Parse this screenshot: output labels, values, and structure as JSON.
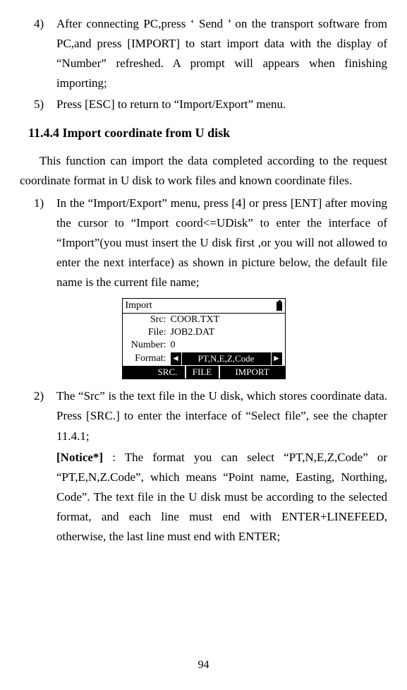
{
  "list": {
    "item4": {
      "marker": "4)",
      "text": "After connecting PC,press ‘ Send ’ on the transport software from PC,and press [IMPORT] to start import data with the display of “Number” refreshed. A prompt will appears when finishing importing;"
    },
    "item5": {
      "marker": "5)",
      "text": "Press [ESC] to return to “Import/Export” menu."
    }
  },
  "heading": "11.4.4 Import coordinate from U disk",
  "intro": "This function can import the data completed according to the request coordinate format in U disk to work files and known coordinate files.",
  "steps": {
    "s1": {
      "marker": "1)",
      "text": "In the “Import/Export” menu, press [4] or press [ENT] after moving the cursor to “Import coord<=UDisk” to enter the interface of “Import”(you must insert the U disk first ,or you will not allowed to enter the next interface) as shown in picture below, the default file name is the current file name;"
    },
    "s2": {
      "marker": "2)",
      "text": "The “Src” is the text file in the U disk, which stores coordinate data. Press [SRC.] to enter the interface of “Select file”, see the chapter 11.4.1;"
    },
    "s2notice": "[Notice*] : The format you can select “PT,N,E,Z,Code” or “PT,E,N,Z.Code”, which means “Point name, Easting, Northing, Code”. The text file in the U disk must be according to the selected format, and each line must end with ENTER+LINEFEED, otherwise, the last line must end with ENTER;"
  },
  "diagram": {
    "title": "Import",
    "labels": {
      "src": "Src:",
      "file": "File:",
      "number": "Number:",
      "format": "Format:"
    },
    "values": {
      "src": "COOR.TXT",
      "file": "JOB2.DAT",
      "number": "0",
      "format": "PT,N,E,Z,Code"
    },
    "arrows": {
      "left": "◄",
      "right": "►"
    },
    "softkeys": {
      "k1": "SRC.",
      "k2": "FILE",
      "k3": "IMPORT"
    }
  },
  "pageNumber": "94"
}
